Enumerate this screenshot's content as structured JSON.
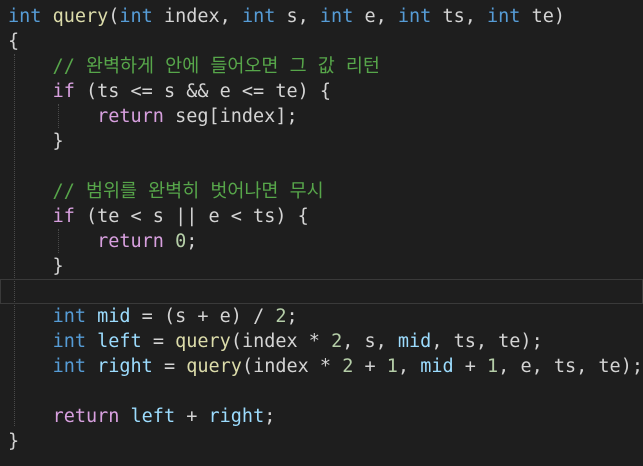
{
  "colors": {
    "background": "#1e1e1e",
    "plain": "#d4d4d4",
    "keyword_type": "#569cd6",
    "keyword_control": "#d8a0df",
    "function": "#dcdcaa",
    "parameter": "#9cdcfe",
    "number": "#b5cea8",
    "comment": "#57a64a",
    "local_variable": "#9cdcfe"
  },
  "code": {
    "lines": [
      {
        "tokens": [
          {
            "t": "int",
            "k": "type"
          },
          {
            "t": " ",
            "k": "plain"
          },
          {
            "t": "query",
            "k": "func"
          },
          {
            "t": "(",
            "k": "plain"
          },
          {
            "t": "int",
            "k": "type"
          },
          {
            "t": " index, ",
            "k": "plain"
          },
          {
            "t": "int",
            "k": "type"
          },
          {
            "t": " s, ",
            "k": "plain"
          },
          {
            "t": "int",
            "k": "type"
          },
          {
            "t": " e, ",
            "k": "plain"
          },
          {
            "t": "int",
            "k": "type"
          },
          {
            "t": " ts, ",
            "k": "plain"
          },
          {
            "t": "int",
            "k": "type"
          },
          {
            "t": " te)",
            "k": "plain"
          }
        ]
      },
      {
        "tokens": [
          {
            "t": "{",
            "k": "plain"
          }
        ]
      },
      {
        "tokens": [
          {
            "t": "    // 완벽하게 안에 들어오면 그 값 리턴",
            "k": "comment"
          }
        ]
      },
      {
        "tokens": [
          {
            "t": "    ",
            "k": "plain"
          },
          {
            "t": "if",
            "k": "control"
          },
          {
            "t": " (ts <= s && e <= te) {",
            "k": "plain"
          }
        ]
      },
      {
        "tokens": [
          {
            "t": "        ",
            "k": "plain"
          },
          {
            "t": "return",
            "k": "control"
          },
          {
            "t": " seg[index];",
            "k": "plain"
          }
        ]
      },
      {
        "tokens": [
          {
            "t": "    }",
            "k": "plain"
          }
        ]
      },
      {
        "tokens": []
      },
      {
        "tokens": [
          {
            "t": "    // 범위를 완벽히 벗어나면 무시",
            "k": "comment"
          }
        ]
      },
      {
        "tokens": [
          {
            "t": "    ",
            "k": "plain"
          },
          {
            "t": "if",
            "k": "control"
          },
          {
            "t": " (te < s || e < ts) {",
            "k": "plain"
          }
        ]
      },
      {
        "tokens": [
          {
            "t": "        ",
            "k": "plain"
          },
          {
            "t": "return",
            "k": "control"
          },
          {
            "t": " ",
            "k": "plain"
          },
          {
            "t": "0",
            "k": "number"
          },
          {
            "t": ";",
            "k": "plain"
          }
        ]
      },
      {
        "tokens": [
          {
            "t": "    }",
            "k": "plain"
          }
        ]
      },
      {
        "tokens": [],
        "current": true
      },
      {
        "tokens": [
          {
            "t": "    ",
            "k": "plain"
          },
          {
            "t": "int",
            "k": "type"
          },
          {
            "t": " ",
            "k": "plain"
          },
          {
            "t": "mid",
            "k": "local"
          },
          {
            "t": " = (s + e) / ",
            "k": "plain"
          },
          {
            "t": "2",
            "k": "number"
          },
          {
            "t": ";",
            "k": "plain"
          }
        ]
      },
      {
        "tokens": [
          {
            "t": "    ",
            "k": "plain"
          },
          {
            "t": "int",
            "k": "type"
          },
          {
            "t": " ",
            "k": "plain"
          },
          {
            "t": "left",
            "k": "local"
          },
          {
            "t": " = ",
            "k": "plain"
          },
          {
            "t": "query",
            "k": "func"
          },
          {
            "t": "(index * ",
            "k": "plain"
          },
          {
            "t": "2",
            "k": "number"
          },
          {
            "t": ", s, ",
            "k": "plain"
          },
          {
            "t": "mid",
            "k": "local"
          },
          {
            "t": ", ts, te);",
            "k": "plain"
          }
        ]
      },
      {
        "tokens": [
          {
            "t": "    ",
            "k": "plain"
          },
          {
            "t": "int",
            "k": "type"
          },
          {
            "t": " ",
            "k": "plain"
          },
          {
            "t": "right",
            "k": "local"
          },
          {
            "t": " = ",
            "k": "plain"
          },
          {
            "t": "query",
            "k": "func"
          },
          {
            "t": "(index * ",
            "k": "plain"
          },
          {
            "t": "2",
            "k": "number"
          },
          {
            "t": " + ",
            "k": "plain"
          },
          {
            "t": "1",
            "k": "number"
          },
          {
            "t": ", ",
            "k": "plain"
          },
          {
            "t": "mid",
            "k": "local"
          },
          {
            "t": " + ",
            "k": "plain"
          },
          {
            "t": "1",
            "k": "number"
          },
          {
            "t": ", e, ts, te);",
            "k": "plain"
          }
        ]
      },
      {
        "tokens": []
      },
      {
        "tokens": [
          {
            "t": "    ",
            "k": "plain"
          },
          {
            "t": "return",
            "k": "control"
          },
          {
            "t": " ",
            "k": "plain"
          },
          {
            "t": "left",
            "k": "local"
          },
          {
            "t": " + ",
            "k": "plain"
          },
          {
            "t": "right",
            "k": "local"
          },
          {
            "t": ";",
            "k": "plain"
          }
        ]
      },
      {
        "tokens": [
          {
            "t": "}",
            "k": "plain"
          }
        ]
      }
    ]
  }
}
